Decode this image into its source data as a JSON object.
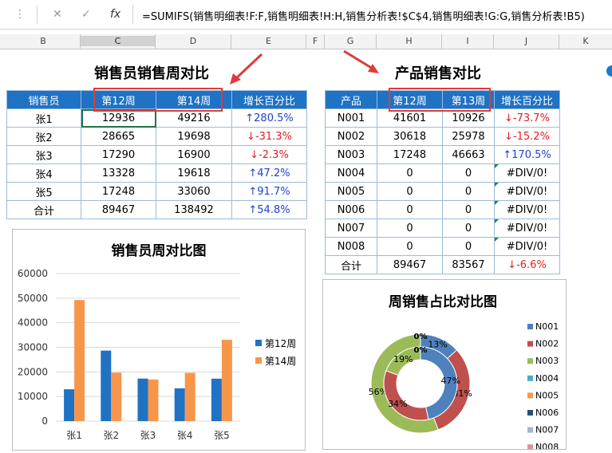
{
  "formula_bar": {
    "cancel_icon": "✕",
    "enter_icon": "✓",
    "fx_label": "fx",
    "formula": "=SUMIFS(销售明细表!F:F,销售明细表!H:H,销售分析表!$C$4,销售明细表!G:G,销售分析表!B5)"
  },
  "columns": [
    "B",
    "C",
    "D",
    "E",
    "F",
    "G",
    "H",
    "I",
    "J",
    "K"
  ],
  "left_table": {
    "title": "销售员销售周对比",
    "headers": [
      "销售员",
      "第12周",
      "第14周",
      "增长百分比"
    ],
    "rows": [
      {
        "name": "张1",
        "w12": "12936",
        "w14": "49216",
        "growth": "↑280.5%",
        "dir": "up"
      },
      {
        "name": "张2",
        "w12": "28665",
        "w14": "19698",
        "growth": "↓-31.3%",
        "dir": "down"
      },
      {
        "name": "张3",
        "w12": "17290",
        "w14": "16900",
        "growth": "↓-2.3%",
        "dir": "down"
      },
      {
        "name": "张4",
        "w12": "13328",
        "w14": "19618",
        "growth": "↑47.2%",
        "dir": "up"
      },
      {
        "name": "张5",
        "w12": "17248",
        "w14": "33060",
        "growth": "↑91.7%",
        "dir": "up"
      },
      {
        "name": "合计",
        "w12": "89467",
        "w14": "138492",
        "growth": "↑54.8%",
        "dir": "up"
      }
    ]
  },
  "right_table": {
    "title": "产品销售对比",
    "headers": [
      "产品",
      "第12周",
      "第13周",
      "增长百分比"
    ],
    "rows": [
      {
        "name": "N001",
        "w12": "41601",
        "w13": "10926",
        "growth": "↓-73.7%",
        "dir": "down"
      },
      {
        "name": "N002",
        "w12": "30618",
        "w13": "25978",
        "growth": "↓-15.2%",
        "dir": "down"
      },
      {
        "name": "N003",
        "w12": "17248",
        "w13": "46663",
        "growth": "↑170.5%",
        "dir": "up"
      },
      {
        "name": "N004",
        "w12": "0",
        "w13": "0",
        "growth": "#DIV/0!",
        "dir": "err"
      },
      {
        "name": "N005",
        "w12": "0",
        "w13": "0",
        "growth": "#DIV/0!",
        "dir": "err"
      },
      {
        "name": "N006",
        "w12": "0",
        "w13": "0",
        "growth": "#DIV/0!",
        "dir": "err"
      },
      {
        "name": "N007",
        "w12": "0",
        "w13": "0",
        "growth": "#DIV/0!",
        "dir": "err"
      },
      {
        "name": "N008",
        "w12": "0",
        "w13": "0",
        "growth": "#DIV/0!",
        "dir": "err"
      },
      {
        "name": "合计",
        "w12": "89467",
        "w13": "83567",
        "growth": "↓-6.6%",
        "dir": "down"
      }
    ]
  },
  "chart_data": [
    {
      "type": "bar",
      "title": "销售员周对比图",
      "categories": [
        "张1",
        "张2",
        "张3",
        "张4",
        "张5"
      ],
      "series": [
        {
          "name": "第12周",
          "values": [
            12936,
            28665,
            17290,
            13328,
            17248
          ],
          "color": "#1f72c4"
        },
        {
          "name": "第14周",
          "values": [
            49216,
            19698,
            16900,
            19618,
            33060
          ],
          "color": "#f7964a"
        }
      ],
      "ylim": [
        0,
        60000
      ],
      "yticks": [
        "0",
        "10000",
        "20000",
        "30000",
        "40000",
        "50000",
        "60000"
      ],
      "legend": "right"
    },
    {
      "type": "pie",
      "variant": "doughnut",
      "title": "周销售占比对比图",
      "categories": [
        "N001",
        "N002",
        "N003",
        "N004",
        "N005",
        "N006",
        "N007",
        "N008"
      ],
      "colors": [
        "#4f81bd",
        "#c0504d",
        "#9bbb59",
        "#4bacc6",
        "#f79646",
        "#2c4d75",
        "#a5b5d6",
        "#d99694"
      ],
      "series": [
        {
          "ring": "outer",
          "values": [
            10926,
            25978,
            46663,
            0,
            0,
            0,
            0,
            0
          ],
          "labels": [
            "13%",
            "31%",
            "56%",
            "0%",
            "0%",
            "0%",
            "0%",
            "0%"
          ]
        },
        {
          "ring": "inner",
          "values": [
            41601,
            30618,
            17248,
            0,
            0,
            0,
            0,
            0
          ],
          "labels": [
            "47%",
            "34%",
            "19%",
            "0%",
            "0%",
            "0%",
            "0%",
            "0%"
          ]
        }
      ],
      "legend": "right"
    }
  ]
}
